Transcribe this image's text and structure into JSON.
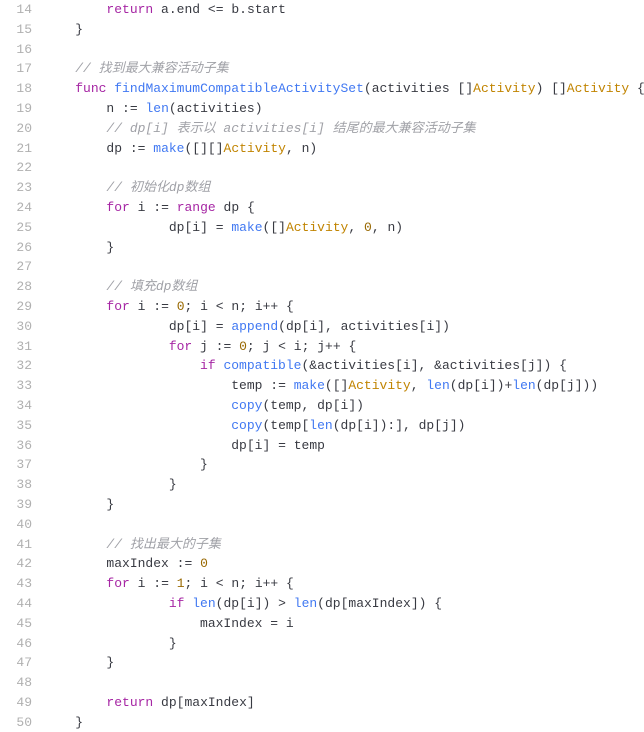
{
  "startLine": 14,
  "lines": [
    {
      "n": 14,
      "ind": 2,
      "t": [
        [
          "kw",
          "return"
        ],
        [
          "sp",
          " "
        ],
        [
          "id",
          "a"
        ],
        [
          "punc",
          "."
        ],
        [
          "id",
          "end"
        ],
        [
          "sp",
          " "
        ],
        [
          "op",
          "<="
        ],
        [
          "sp",
          " "
        ],
        [
          "id",
          "b"
        ],
        [
          "punc",
          "."
        ],
        [
          "id",
          "start"
        ]
      ]
    },
    {
      "n": 15,
      "ind": 1,
      "t": [
        [
          "punc",
          "}"
        ]
      ]
    },
    {
      "n": 16,
      "ind": 0,
      "t": []
    },
    {
      "n": 17,
      "ind": 1,
      "t": [
        [
          "cmt",
          "// 找到最大兼容活动子集"
        ]
      ]
    },
    {
      "n": 18,
      "ind": 1,
      "t": [
        [
          "kw",
          "func"
        ],
        [
          "sp",
          " "
        ],
        [
          "fn",
          "findMaximumCompatibleActivitySet"
        ],
        [
          "punc",
          "("
        ],
        [
          "id",
          "activities"
        ],
        [
          "sp",
          " "
        ],
        [
          "punc",
          "[]"
        ],
        [
          "type",
          "Activity"
        ],
        [
          "punc",
          ")"
        ],
        [
          "sp",
          " "
        ],
        [
          "punc",
          "[]"
        ],
        [
          "type",
          "Activity"
        ],
        [
          "sp",
          " "
        ],
        [
          "punc",
          "{"
        ]
      ]
    },
    {
      "n": 19,
      "ind": 2,
      "t": [
        [
          "id",
          "n"
        ],
        [
          "sp",
          " "
        ],
        [
          "op",
          ":="
        ],
        [
          "sp",
          " "
        ],
        [
          "builtin",
          "len"
        ],
        [
          "punc",
          "("
        ],
        [
          "id",
          "activities"
        ],
        [
          "punc",
          ")"
        ]
      ]
    },
    {
      "n": 20,
      "ind": 2,
      "t": [
        [
          "cmt",
          "// dp[i] 表示以 activities[i] 结尾的最大兼容活动子集"
        ]
      ]
    },
    {
      "n": 21,
      "ind": 2,
      "t": [
        [
          "id",
          "dp"
        ],
        [
          "sp",
          " "
        ],
        [
          "op",
          ":="
        ],
        [
          "sp",
          " "
        ],
        [
          "builtin",
          "make"
        ],
        [
          "punc",
          "("
        ],
        [
          "punc",
          "[][]"
        ],
        [
          "type",
          "Activity"
        ],
        [
          "punc",
          ","
        ],
        [
          "sp",
          " "
        ],
        [
          "id",
          "n"
        ],
        [
          "punc",
          ")"
        ]
      ]
    },
    {
      "n": 22,
      "ind": 0,
      "t": []
    },
    {
      "n": 23,
      "ind": 2,
      "t": [
        [
          "cmt",
          "// 初始化dp数组"
        ]
      ]
    },
    {
      "n": 24,
      "ind": 2,
      "t": [
        [
          "kw",
          "for"
        ],
        [
          "sp",
          " "
        ],
        [
          "id",
          "i"
        ],
        [
          "sp",
          " "
        ],
        [
          "op",
          ":="
        ],
        [
          "sp",
          " "
        ],
        [
          "kw",
          "range"
        ],
        [
          "sp",
          " "
        ],
        [
          "id",
          "dp"
        ],
        [
          "sp",
          " "
        ],
        [
          "punc",
          "{"
        ]
      ]
    },
    {
      "n": 25,
      "ind": 4,
      "t": [
        [
          "id",
          "dp"
        ],
        [
          "punc",
          "["
        ],
        [
          "id",
          "i"
        ],
        [
          "punc",
          "]"
        ],
        [
          "sp",
          " "
        ],
        [
          "op",
          "="
        ],
        [
          "sp",
          " "
        ],
        [
          "builtin",
          "make"
        ],
        [
          "punc",
          "("
        ],
        [
          "punc",
          "[]"
        ],
        [
          "type",
          "Activity"
        ],
        [
          "punc",
          ","
        ],
        [
          "sp",
          " "
        ],
        [
          "num",
          "0"
        ],
        [
          "punc",
          ","
        ],
        [
          "sp",
          " "
        ],
        [
          "id",
          "n"
        ],
        [
          "punc",
          ")"
        ]
      ]
    },
    {
      "n": 26,
      "ind": 2,
      "t": [
        [
          "punc",
          "}"
        ]
      ]
    },
    {
      "n": 27,
      "ind": 0,
      "t": []
    },
    {
      "n": 28,
      "ind": 2,
      "t": [
        [
          "cmt",
          "// 填充dp数组"
        ]
      ]
    },
    {
      "n": 29,
      "ind": 2,
      "t": [
        [
          "kw",
          "for"
        ],
        [
          "sp",
          " "
        ],
        [
          "id",
          "i"
        ],
        [
          "sp",
          " "
        ],
        [
          "op",
          ":="
        ],
        [
          "sp",
          " "
        ],
        [
          "num",
          "0"
        ],
        [
          "punc",
          ";"
        ],
        [
          "sp",
          " "
        ],
        [
          "id",
          "i"
        ],
        [
          "sp",
          " "
        ],
        [
          "op",
          "<"
        ],
        [
          "sp",
          " "
        ],
        [
          "id",
          "n"
        ],
        [
          "punc",
          ";"
        ],
        [
          "sp",
          " "
        ],
        [
          "id",
          "i"
        ],
        [
          "op",
          "++"
        ],
        [
          "sp",
          " "
        ],
        [
          "punc",
          "{"
        ]
      ]
    },
    {
      "n": 30,
      "ind": 4,
      "t": [
        [
          "id",
          "dp"
        ],
        [
          "punc",
          "["
        ],
        [
          "id",
          "i"
        ],
        [
          "punc",
          "]"
        ],
        [
          "sp",
          " "
        ],
        [
          "op",
          "="
        ],
        [
          "sp",
          " "
        ],
        [
          "builtin",
          "append"
        ],
        [
          "punc",
          "("
        ],
        [
          "id",
          "dp"
        ],
        [
          "punc",
          "["
        ],
        [
          "id",
          "i"
        ],
        [
          "punc",
          "]"
        ],
        [
          "punc",
          ","
        ],
        [
          "sp",
          " "
        ],
        [
          "id",
          "activities"
        ],
        [
          "punc",
          "["
        ],
        [
          "id",
          "i"
        ],
        [
          "punc",
          "]"
        ],
        [
          "punc",
          ")"
        ]
      ]
    },
    {
      "n": 31,
      "ind": 4,
      "t": [
        [
          "kw",
          "for"
        ],
        [
          "sp",
          " "
        ],
        [
          "id",
          "j"
        ],
        [
          "sp",
          " "
        ],
        [
          "op",
          ":="
        ],
        [
          "sp",
          " "
        ],
        [
          "num",
          "0"
        ],
        [
          "punc",
          ";"
        ],
        [
          "sp",
          " "
        ],
        [
          "id",
          "j"
        ],
        [
          "sp",
          " "
        ],
        [
          "op",
          "<"
        ],
        [
          "sp",
          " "
        ],
        [
          "id",
          "i"
        ],
        [
          "punc",
          ";"
        ],
        [
          "sp",
          " "
        ],
        [
          "id",
          "j"
        ],
        [
          "op",
          "++"
        ],
        [
          "sp",
          " "
        ],
        [
          "punc",
          "{"
        ]
      ]
    },
    {
      "n": 32,
      "ind": 5,
      "t": [
        [
          "kw",
          "if"
        ],
        [
          "sp",
          " "
        ],
        [
          "fn",
          "compatible"
        ],
        [
          "punc",
          "("
        ],
        [
          "op",
          "&"
        ],
        [
          "id",
          "activities"
        ],
        [
          "punc",
          "["
        ],
        [
          "id",
          "i"
        ],
        [
          "punc",
          "]"
        ],
        [
          "punc",
          ","
        ],
        [
          "sp",
          " "
        ],
        [
          "op",
          "&"
        ],
        [
          "id",
          "activities"
        ],
        [
          "punc",
          "["
        ],
        [
          "id",
          "j"
        ],
        [
          "punc",
          "]"
        ],
        [
          "punc",
          ")"
        ],
        [
          "sp",
          " "
        ],
        [
          "punc",
          "{"
        ]
      ]
    },
    {
      "n": 33,
      "ind": 6,
      "t": [
        [
          "id",
          "temp"
        ],
        [
          "sp",
          " "
        ],
        [
          "op",
          ":="
        ],
        [
          "sp",
          " "
        ],
        [
          "builtin",
          "make"
        ],
        [
          "punc",
          "("
        ],
        [
          "punc",
          "[]"
        ],
        [
          "type",
          "Activity"
        ],
        [
          "punc",
          ","
        ],
        [
          "sp",
          " "
        ],
        [
          "builtin",
          "len"
        ],
        [
          "punc",
          "("
        ],
        [
          "id",
          "dp"
        ],
        [
          "punc",
          "["
        ],
        [
          "id",
          "i"
        ],
        [
          "punc",
          "]"
        ],
        [
          "punc",
          ")"
        ],
        [
          "op",
          "+"
        ],
        [
          "builtin",
          "len"
        ],
        [
          "punc",
          "("
        ],
        [
          "id",
          "dp"
        ],
        [
          "punc",
          "["
        ],
        [
          "id",
          "j"
        ],
        [
          "punc",
          "]"
        ],
        [
          "punc",
          ")"
        ],
        [
          "punc",
          ")"
        ]
      ]
    },
    {
      "n": 34,
      "ind": 6,
      "t": [
        [
          "builtin",
          "copy"
        ],
        [
          "punc",
          "("
        ],
        [
          "id",
          "temp"
        ],
        [
          "punc",
          ","
        ],
        [
          "sp",
          " "
        ],
        [
          "id",
          "dp"
        ],
        [
          "punc",
          "["
        ],
        [
          "id",
          "i"
        ],
        [
          "punc",
          "]"
        ],
        [
          "punc",
          ")"
        ]
      ]
    },
    {
      "n": 35,
      "ind": 6,
      "t": [
        [
          "builtin",
          "copy"
        ],
        [
          "punc",
          "("
        ],
        [
          "id",
          "temp"
        ],
        [
          "punc",
          "["
        ],
        [
          "builtin",
          "len"
        ],
        [
          "punc",
          "("
        ],
        [
          "id",
          "dp"
        ],
        [
          "punc",
          "["
        ],
        [
          "id",
          "i"
        ],
        [
          "punc",
          "]"
        ],
        [
          "punc",
          ")"
        ],
        [
          "punc",
          ":"
        ],
        [
          "punc",
          "]"
        ],
        [
          "punc",
          ","
        ],
        [
          "sp",
          " "
        ],
        [
          "id",
          "dp"
        ],
        [
          "punc",
          "["
        ],
        [
          "id",
          "j"
        ],
        [
          "punc",
          "]"
        ],
        [
          "punc",
          ")"
        ]
      ]
    },
    {
      "n": 36,
      "ind": 6,
      "t": [
        [
          "id",
          "dp"
        ],
        [
          "punc",
          "["
        ],
        [
          "id",
          "i"
        ],
        [
          "punc",
          "]"
        ],
        [
          "sp",
          " "
        ],
        [
          "op",
          "="
        ],
        [
          "sp",
          " "
        ],
        [
          "id",
          "temp"
        ]
      ]
    },
    {
      "n": 37,
      "ind": 5,
      "t": [
        [
          "punc",
          "}"
        ]
      ]
    },
    {
      "n": 38,
      "ind": 4,
      "t": [
        [
          "punc",
          "}"
        ]
      ]
    },
    {
      "n": 39,
      "ind": 2,
      "t": [
        [
          "punc",
          "}"
        ]
      ]
    },
    {
      "n": 40,
      "ind": 0,
      "t": []
    },
    {
      "n": 41,
      "ind": 2,
      "t": [
        [
          "cmt",
          "// 找出最大的子集"
        ]
      ]
    },
    {
      "n": 42,
      "ind": 2,
      "t": [
        [
          "id",
          "maxIndex"
        ],
        [
          "sp",
          " "
        ],
        [
          "op",
          ":="
        ],
        [
          "sp",
          " "
        ],
        [
          "num",
          "0"
        ]
      ]
    },
    {
      "n": 43,
      "ind": 2,
      "t": [
        [
          "kw",
          "for"
        ],
        [
          "sp",
          " "
        ],
        [
          "id",
          "i"
        ],
        [
          "sp",
          " "
        ],
        [
          "op",
          ":="
        ],
        [
          "sp",
          " "
        ],
        [
          "num",
          "1"
        ],
        [
          "punc",
          ";"
        ],
        [
          "sp",
          " "
        ],
        [
          "id",
          "i"
        ],
        [
          "sp",
          " "
        ],
        [
          "op",
          "<"
        ],
        [
          "sp",
          " "
        ],
        [
          "id",
          "n"
        ],
        [
          "punc",
          ";"
        ],
        [
          "sp",
          " "
        ],
        [
          "id",
          "i"
        ],
        [
          "op",
          "++"
        ],
        [
          "sp",
          " "
        ],
        [
          "punc",
          "{"
        ]
      ]
    },
    {
      "n": 44,
      "ind": 4,
      "t": [
        [
          "kw",
          "if"
        ],
        [
          "sp",
          " "
        ],
        [
          "builtin",
          "len"
        ],
        [
          "punc",
          "("
        ],
        [
          "id",
          "dp"
        ],
        [
          "punc",
          "["
        ],
        [
          "id",
          "i"
        ],
        [
          "punc",
          "]"
        ],
        [
          "punc",
          ")"
        ],
        [
          "sp",
          " "
        ],
        [
          "op",
          ">"
        ],
        [
          "sp",
          " "
        ],
        [
          "builtin",
          "len"
        ],
        [
          "punc",
          "("
        ],
        [
          "id",
          "dp"
        ],
        [
          "punc",
          "["
        ],
        [
          "id",
          "maxIndex"
        ],
        [
          "punc",
          "]"
        ],
        [
          "punc",
          ")"
        ],
        [
          "sp",
          " "
        ],
        [
          "punc",
          "{"
        ]
      ]
    },
    {
      "n": 45,
      "ind": 5,
      "t": [
        [
          "id",
          "maxIndex"
        ],
        [
          "sp",
          " "
        ],
        [
          "op",
          "="
        ],
        [
          "sp",
          " "
        ],
        [
          "id",
          "i"
        ]
      ]
    },
    {
      "n": 46,
      "ind": 4,
      "t": [
        [
          "punc",
          "}"
        ]
      ]
    },
    {
      "n": 47,
      "ind": 2,
      "t": [
        [
          "punc",
          "}"
        ]
      ]
    },
    {
      "n": 48,
      "ind": 0,
      "t": []
    },
    {
      "n": 49,
      "ind": 2,
      "t": [
        [
          "kw",
          "return"
        ],
        [
          "sp",
          " "
        ],
        [
          "id",
          "dp"
        ],
        [
          "punc",
          "["
        ],
        [
          "id",
          "maxIndex"
        ],
        [
          "punc",
          "]"
        ]
      ]
    },
    {
      "n": 50,
      "ind": 1,
      "t": [
        [
          "punc",
          "}"
        ]
      ]
    }
  ]
}
